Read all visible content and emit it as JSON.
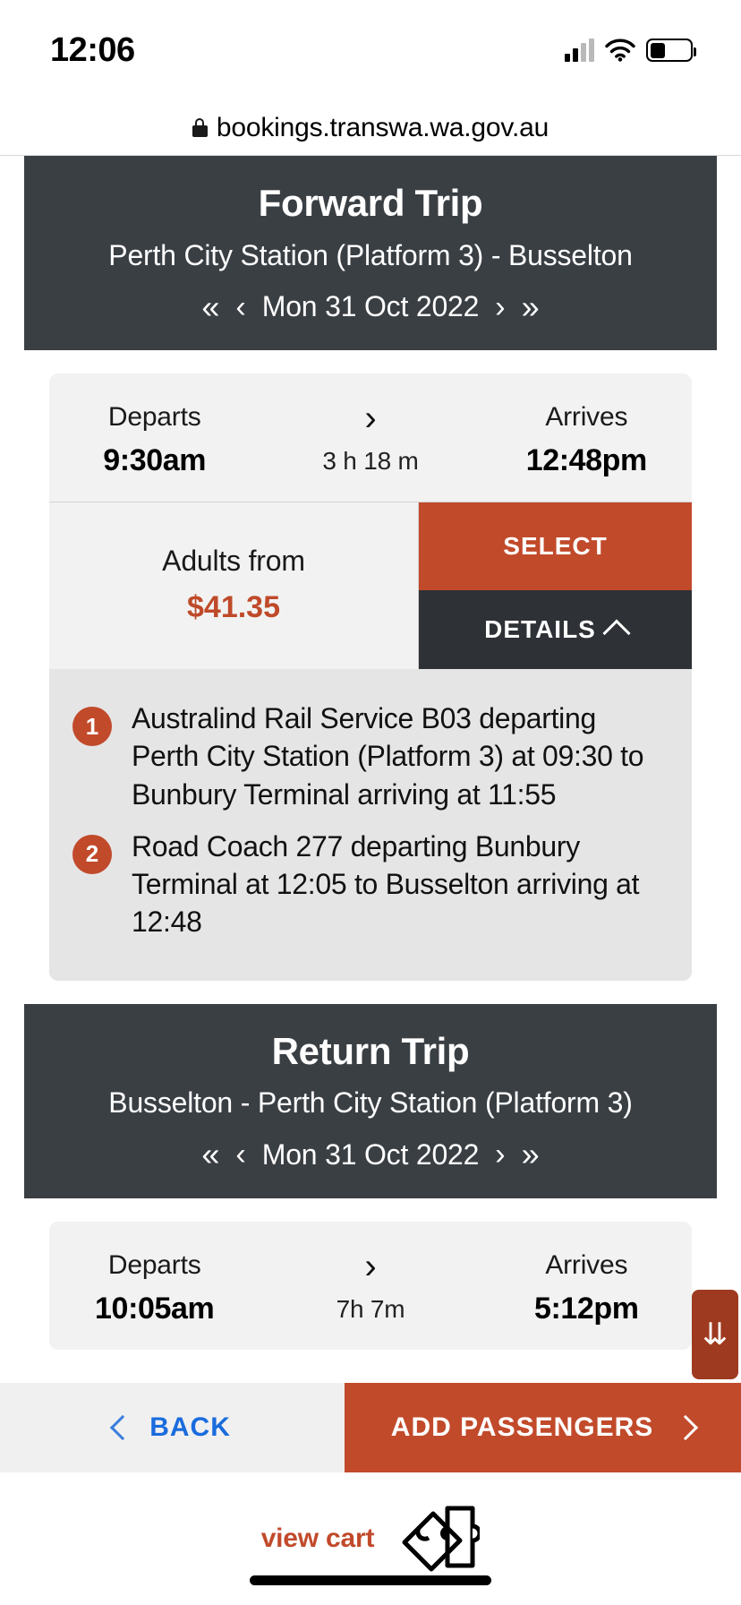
{
  "status_bar": {
    "time": "12:06",
    "signal_icon": "cellular-signal-icon",
    "wifi_icon": "wifi-icon",
    "battery_icon": "battery-icon"
  },
  "browser": {
    "lock_icon": "lock-icon",
    "url": "bookings.transwa.wa.gov.au"
  },
  "forward_trip": {
    "title": "Forward Trip",
    "route": "Perth City Station (Platform 3) - Busselton",
    "date": "Mon 31 Oct 2022",
    "nav": {
      "first": "«",
      "prev": "‹",
      "next": "›",
      "last": "»"
    },
    "journey": {
      "departs_label": "Departs",
      "departs_time": "9:30am",
      "duration": "3 h 18 m",
      "arrives_label": "Arrives",
      "arrives_time": "12:48pm",
      "fare_label": "Adults from",
      "fare_price": "$41.35",
      "select_label": "SELECT",
      "details_label": "DETAILS",
      "legs": [
        {
          "number": "1",
          "text": "Australind Rail Service B03 departing Perth City Station (Platform 3) at 09:30 to Bunbury Terminal arriving at 11:55"
        },
        {
          "number": "2",
          "text": "Road Coach 277 departing Bunbury Terminal at 12:05 to Busselton arriving at 12:48"
        }
      ]
    }
  },
  "return_trip": {
    "title": "Return Trip",
    "route": "Busselton - Perth City Station (Platform 3)",
    "date": "Mon 31 Oct 2022",
    "nav": {
      "first": "«",
      "prev": "‹",
      "next": "›",
      "last": "»"
    },
    "journey": {
      "departs_label": "Departs",
      "departs_time": "10:05am",
      "duration": "7h 7m",
      "arrives_label": "Arrives",
      "arrives_time": "5:12pm"
    }
  },
  "scroll_hint": {
    "icon": "double-down-arrow-icon",
    "glyph": "⇊"
  },
  "bottom_bar": {
    "back_label": "BACK",
    "next_label": "ADD PASSENGERS"
  },
  "cart": {
    "label": "view cart",
    "icon": "tickets-icon"
  },
  "colors": {
    "accent": "#c14a2b",
    "header_dark": "#3a3f44",
    "details_dark": "#2e3135",
    "card_gray": "#f2f2f2",
    "legs_gray": "#e5e5e5",
    "link_blue": "#1a6bdd"
  }
}
